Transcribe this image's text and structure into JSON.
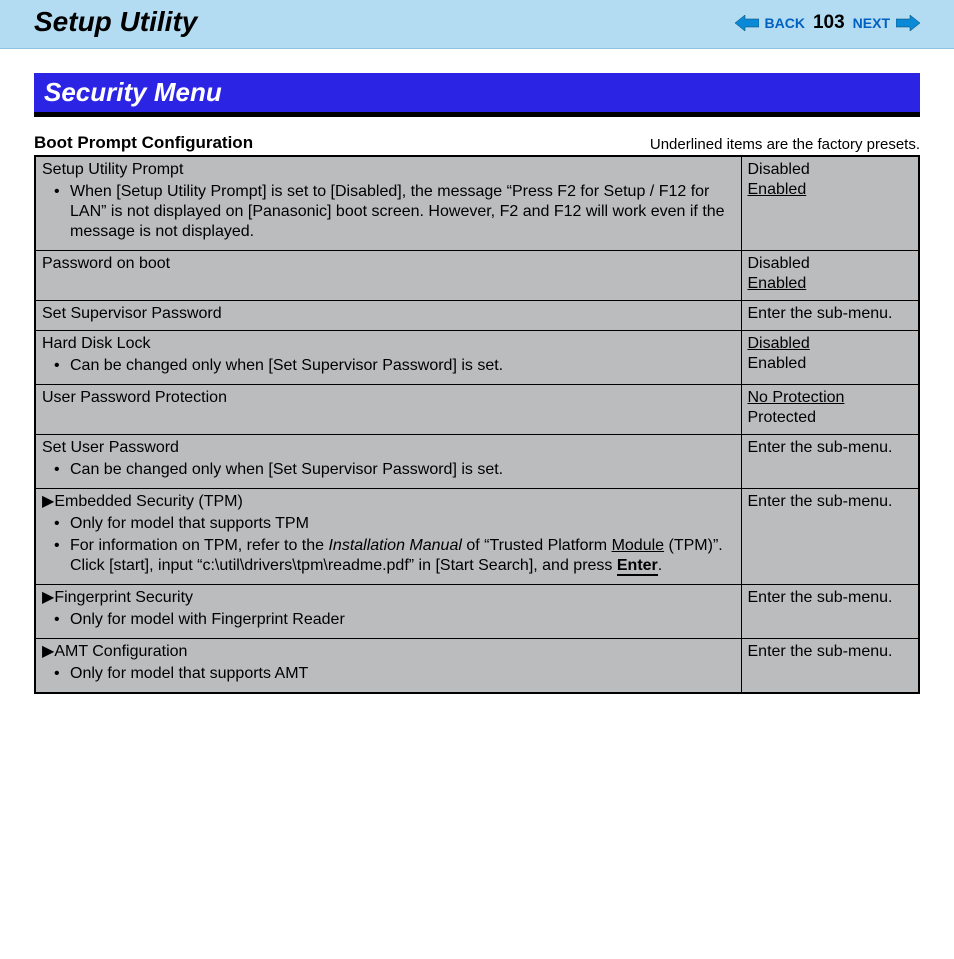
{
  "header": {
    "title": "Setup Utility",
    "back": "BACK",
    "page_number": "103",
    "next": "NEXT"
  },
  "section": {
    "title": "Security Menu",
    "subhead": "Boot Prompt Configuration",
    "preset_note": "Underlined items are the factory presets."
  },
  "rows": {
    "r0": {
      "title": "Setup Utility Prompt",
      "bullet0": "When [Setup Utility Prompt] is set to [Disabled], the message “Press F2 for Setup / F12 for LAN” is not displayed on [Panasonic] boot screen. However, F2 and F12 will work even if the message is not displayed.",
      "val0": "Disabled",
      "val1": "Enabled"
    },
    "r1": {
      "title": "Password on boot",
      "val0": "Disabled",
      "val1": "Enabled"
    },
    "r2": {
      "title": "Set Supervisor Password",
      "val0": "Enter the sub-menu."
    },
    "r3": {
      "title": "Hard Disk Lock",
      "bullet0": "Can be changed only when [Set Supervisor Password] is set.",
      "val0": "Disabled",
      "val1": "Enabled"
    },
    "r4": {
      "title": "User Password Protection",
      "val0": "No Protection",
      "val1": "Protected"
    },
    "r5": {
      "title": "Set User Password",
      "bullet0": "Can be changed only when [Set Supervisor Password] is set.",
      "val0": "Enter the sub-menu."
    },
    "r6": {
      "title": "Embedded Security (TPM)",
      "bullet0": "Only for model that supports TPM",
      "bullet1_pre": "For information on TPM, refer to the ",
      "bullet1_ital": "Installation Manual",
      "bullet1_mid": " of “Trusted Platform ",
      "bullet1_module": "Module",
      "bullet1_post1": " (TPM)”. Click [start], input “c:\\util\\drivers\\tpm\\readme.pdf” in [Start Search], and press ",
      "enter_key": "Enter",
      "bullet1_end": ".",
      "val0": "Enter the sub-menu."
    },
    "r7": {
      "title": "Fingerprint Security",
      "bullet0": "Only for model with Fingerprint Reader",
      "val0": "Enter the sub-menu."
    },
    "r8": {
      "title": "AMT Configuration",
      "bullet0": "Only for model that supports AMT",
      "val0": "Enter the sub-menu."
    }
  },
  "glyphs": {
    "triangle": "▶"
  }
}
